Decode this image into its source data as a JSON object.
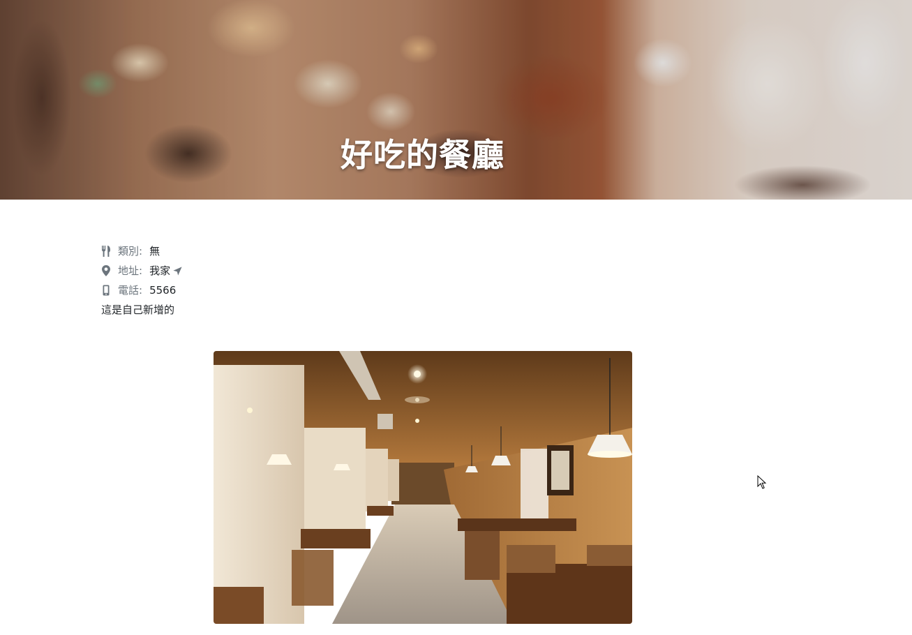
{
  "hero": {
    "title": "好吃的餐廳"
  },
  "details": {
    "category": {
      "label": "類別:",
      "value": "無",
      "icon": "utensils-icon"
    },
    "address": {
      "label": "地址:",
      "value": "我家",
      "icon": "map-marker-icon",
      "link_icon": "location-arrow-icon"
    },
    "phone": {
      "label": "電話:",
      "value": "5566",
      "icon": "mobile-phone-icon"
    },
    "description": "這是自己新增的"
  },
  "colors": {
    "label": "#6c757d",
    "text": "#212529",
    "icon": "#6c757d"
  }
}
